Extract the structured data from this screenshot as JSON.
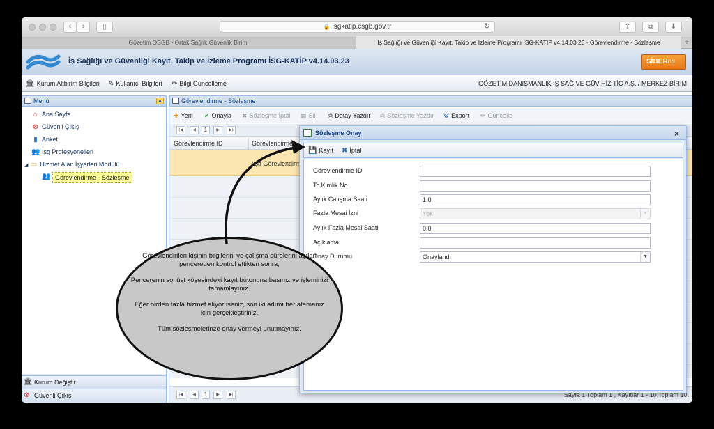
{
  "browser": {
    "url": "isgkatip.csgb.gov.tr",
    "tabs": [
      {
        "label": "Gözetim OSGB - Ortak Sağlık Güvenlik Birimi"
      },
      {
        "label": "İş Sağlığı ve Güvenliği Kayıt, Takip ve İzleme Programı İSG-KATİP v4.14.03.23 - Görevlendirme - Sözleşme"
      }
    ],
    "new_tab": "+"
  },
  "app": {
    "title": "İş Sağlığı ve Güvenliği Kayıt, Takip ve İzleme Programı İSG-KATİP v4.14.03.23",
    "brand_main": "SİBER",
    "brand_tail": "ns",
    "toolbar": {
      "items": [
        "Kurum Altbirim Bilgileri",
        "Kullanıcı Bilgileri",
        "Bilgi Güncelleme"
      ],
      "company": "GÖZETİM DANIŞMANLIK İŞ SAĞ VE GÜV HİZ TİC A.Ş. / MERKEZ BİRİM"
    }
  },
  "menu": {
    "title": "Menü",
    "items": [
      {
        "label": "Ana Sayfa",
        "icon": "home-icon"
      },
      {
        "label": "Güvenli Çıkış",
        "icon": "exit-icon"
      },
      {
        "label": "Anket",
        "icon": "chart-icon"
      },
      {
        "label": "Isg Profesyonelleri",
        "icon": "people-icon"
      },
      {
        "label": "Hizmet Alan İşyerleri Modülü",
        "icon": "folder-icon"
      },
      {
        "label": "Görevlendirme - Sözleşme",
        "icon": "people-icon"
      }
    ],
    "footer": [
      "Kurum Değiştir",
      "Güvenli Çıkış"
    ]
  },
  "main": {
    "title": "Görevlendirme - Sözleşme",
    "tools": [
      {
        "label": "Yeni",
        "enabled": true
      },
      {
        "label": "Onayla",
        "enabled": true
      },
      {
        "label": "Sözleşme İptal",
        "enabled": false
      },
      {
        "label": "Sil",
        "enabled": false
      },
      {
        "label": "Detay Yazdır",
        "enabled": true
      },
      {
        "label": "Sözleşme Yazdır",
        "enabled": false
      },
      {
        "label": "Export",
        "enabled": true
      },
      {
        "label": "Güncelle",
        "enabled": false
      }
    ],
    "page": "1",
    "columns": [
      "Görevlendirme ID",
      "Görevlendirme"
    ],
    "selected_row_fragment": "lışa Görevlendirm",
    "page_info": "Sayfa 1 Toplam 1 , Kayıtlar 1 - 10 Toplam 10."
  },
  "dialog": {
    "title": "Sözleşme Onay",
    "close": "×",
    "actions": [
      "Kayıt",
      "İptal"
    ],
    "fields": [
      {
        "label": "Görevlendirme ID",
        "value": ""
      },
      {
        "label": "Tc Kimlik No",
        "value": ""
      },
      {
        "label": "Aylık Çalışma Saati",
        "value": "1,0"
      },
      {
        "label": "Fazla Mesai İzni",
        "value": "Yok"
      },
      {
        "label": "Aylık Fazla Mesai Saati",
        "value": "0,0"
      },
      {
        "label": "Açıklama",
        "value": ""
      },
      {
        "label": "Onay Durumu",
        "value": "Onaylandı"
      }
    ]
  },
  "callout": {
    "paragraphs": [
      "Görevlendirilen kişinin bilgilerini ve çalışma sürelerini açılan pencereden kontrol ettikten sonra;",
      "Pencerenin sol üst köşesindeki kayıt butonuna basınız ve işleminizi tamamlayınız.",
      "Eğer birden fazla hizmet alıyor iseniz, son iki adımı her atamanız için gerçekleştiriniz.",
      "Tüm sözleşmelerinze onay vermeyi unutmayınız."
    ]
  }
}
